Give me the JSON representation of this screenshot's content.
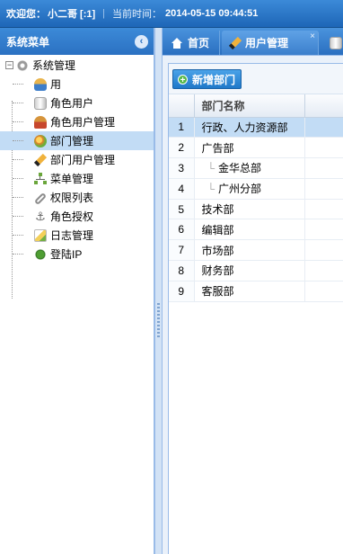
{
  "header": {
    "welcome_label": "欢迎您：",
    "user": "小二哥 [:1]",
    "time_label": "当前时间：",
    "time_value": "2014-05-15 09:44:51"
  },
  "sidebar": {
    "title": "系统菜单",
    "collapse_icon": "chevron-left-icon",
    "root": {
      "label": "系统管理",
      "toggle": "−",
      "icon": "gear-icon"
    },
    "items": [
      {
        "label": "用",
        "icon": "users-icon",
        "selected": false
      },
      {
        "label": "角色用户",
        "icon": "database-icon",
        "selected": false
      },
      {
        "label": "角色用户管理",
        "icon": "people-icon",
        "selected": false
      },
      {
        "label": "部门管理",
        "icon": "globe-icon",
        "selected": true
      },
      {
        "label": "部门用户管理",
        "icon": "pencil-icon",
        "selected": false
      },
      {
        "label": "菜单管理",
        "icon": "sitemap-icon",
        "selected": false
      },
      {
        "label": "权限列表",
        "icon": "link-icon",
        "selected": false
      },
      {
        "label": "角色授权",
        "icon": "anchor-icon",
        "selected": false
      },
      {
        "label": "日志管理",
        "icon": "log-icon",
        "selected": false
      },
      {
        "label": "登陆IP",
        "icon": "bug-icon",
        "selected": false
      }
    ]
  },
  "tabs": [
    {
      "label": "首页",
      "icon": "home-icon",
      "active": false
    },
    {
      "label": "用户管理",
      "icon": "user-tab-icon",
      "active": true,
      "close": "×"
    },
    {
      "label": "",
      "icon": "database-icon",
      "active": false
    }
  ],
  "toolbar": {
    "add_label": "新增部门",
    "add_icon": "+"
  },
  "grid": {
    "column_header": "部门名称",
    "rows": [
      {
        "num": "1",
        "name": "行政、人力资源部",
        "child": false,
        "selected": true
      },
      {
        "num": "2",
        "name": "广告部",
        "child": false,
        "selected": false
      },
      {
        "num": "3",
        "name": "金华总部",
        "child": true,
        "selected": false
      },
      {
        "num": "4",
        "name": "广州分部",
        "child": true,
        "selected": false
      },
      {
        "num": "5",
        "name": "技术部",
        "child": false,
        "selected": false
      },
      {
        "num": "6",
        "name": "编辑部",
        "child": false,
        "selected": false
      },
      {
        "num": "7",
        "name": "市场部",
        "child": false,
        "selected": false
      },
      {
        "num": "8",
        "name": "财务部",
        "child": false,
        "selected": false
      },
      {
        "num": "9",
        "name": "客服部",
        "child": false,
        "selected": false
      }
    ]
  },
  "colors": {
    "accent": "#2b71c2",
    "selected_row": "#c2dcf5",
    "header_blue": "#3c8ad8"
  }
}
